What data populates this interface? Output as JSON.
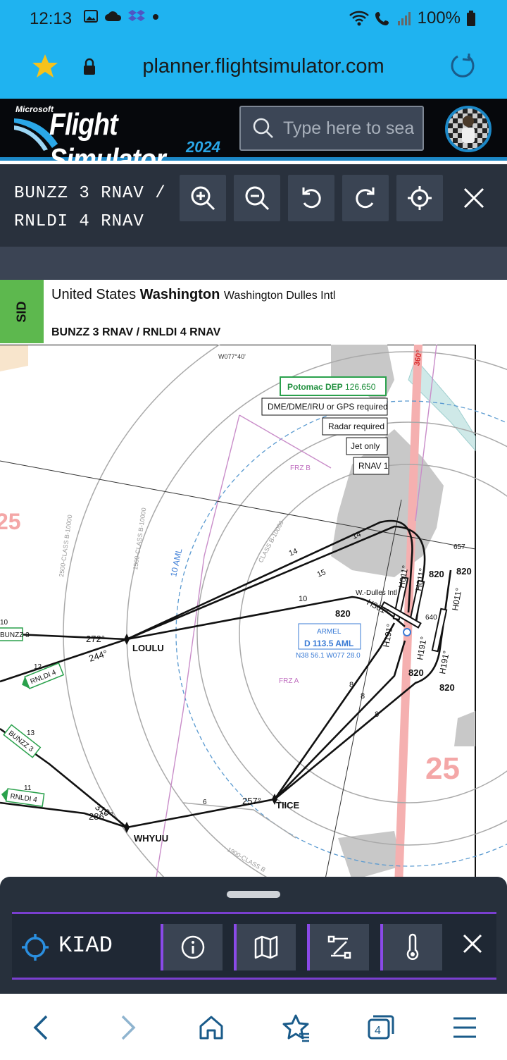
{
  "status": {
    "time": "12:13",
    "battery": "100%"
  },
  "browser": {
    "url": "planner.flightsimulator.com",
    "tabs_count": "4"
  },
  "header": {
    "logo_small": "Microsoft",
    "logo_main": "Flight Simulator",
    "logo_year": "2024",
    "search_placeholder": "Type here to sea"
  },
  "toolbar": {
    "title_line1": "BUNZZ 3 RNAV /",
    "title_line2": "RNLDI 4 RNAV"
  },
  "chart": {
    "tag": "SID",
    "country": "United States",
    "state": "Washington",
    "airport": "Washington Dulles Intl",
    "procedure": "BUNZZ 3 RNAV / RNLDI 4 RNAV",
    "freq_label": "Potomac DEP",
    "freq_value": "126.650",
    "notes": [
      "DME/DME/IRU or GPS required",
      "Radar required",
      "Jet only",
      "RNAV 1"
    ],
    "waypoints": {
      "loulu": "LOULU",
      "tiice": "TIICE",
      "whyuu": "WHYUU"
    },
    "navaid": {
      "name": "ARMEL",
      "freq": "D 113.5 AML",
      "coords": "N38 56.1 W077 28.0"
    },
    "airport_label": "W.-Dulles Intl",
    "lon_label": "W077°40'",
    "heading_360": "360°",
    "frz_b": "FRZ B",
    "frz_a": "FRZ A",
    "aml_10": "10 AML",
    "class_b": [
      "2500-CLASS B-10000",
      "1500-CLASS B-10000",
      "CLASS B-10000",
      "1900-CLASS B"
    ],
    "altitudes": {
      "a1": "820",
      "a2": "820",
      "a3": "820",
      "a4": "820",
      "a5": "820",
      "a6": "820",
      "e640": "640",
      "e657": "657"
    },
    "courses": {
      "c272": "272°",
      "c244": "244°",
      "c257": "257°",
      "c310": "310°",
      "c286": "286°"
    },
    "headings": {
      "h011a": "H011°",
      "h011b": "H011°",
      "h011c": "H011°",
      "h191a": "H191°",
      "h191b": "H191°",
      "h191c": "H191°",
      "h301": "H301°"
    },
    "distances": {
      "d14a": "14",
      "d14b": "14",
      "d15": "15",
      "d10a": "10",
      "d10b": "10",
      "d12": "12",
      "d13": "13",
      "d11": "11",
      "d6": "6",
      "d8a": "8",
      "d8b": "8",
      "d8c": "8"
    },
    "transitions": {
      "bunzz_a": "BUNZZ 3",
      "rnldi_a": "RNLDI 4",
      "bunzz_b": "BUNZZ 3",
      "rnldi_b": "RNLDI 4"
    },
    "sector_25a": "25",
    "sector_25b": "25"
  },
  "panel": {
    "airport_code": "KIAD"
  },
  "colors": {
    "accent": "#1fb3f0",
    "panel": "#27303c",
    "purple": "#8a4ae8",
    "sid_green": "#5db84e",
    "nav_blue": "#1c88c7"
  }
}
